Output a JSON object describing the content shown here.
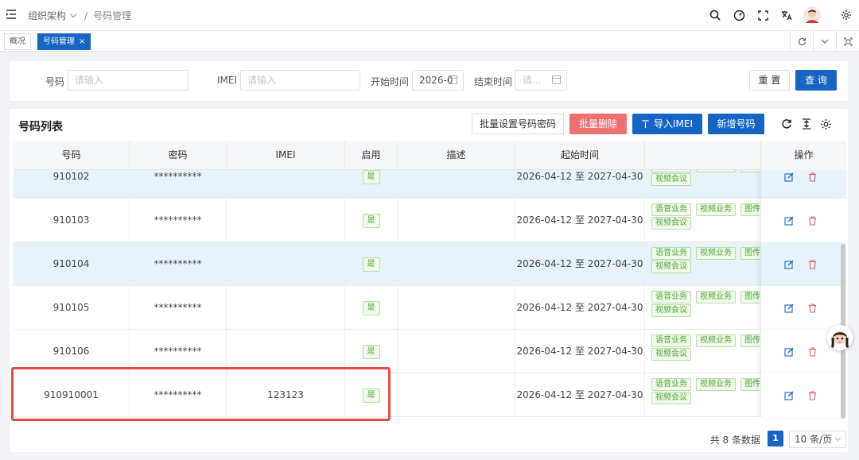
{
  "breadcrumb": {
    "parent": "组织架构",
    "separator": "/",
    "current": "号码管理"
  },
  "tabs": [
    {
      "label": "概况",
      "active": false
    },
    {
      "label": "号码管理",
      "active": true,
      "close": "×"
    }
  ],
  "filters": {
    "number_label": "号码",
    "number_placeholder": "请输入",
    "imei_label": "IMEI",
    "imei_placeholder": "请输入",
    "start_label": "开始时间",
    "start_value": "2026-0",
    "end_label": "结束时间",
    "end_placeholder": "请...",
    "reset_label": "重 置",
    "search_label": "查 询"
  },
  "list": {
    "title": "号码列表",
    "batch_password_label": "批量设置号码密码",
    "batch_delete_label": "批量删除",
    "import_label": "导入IMEI",
    "add_label": "新增号码"
  },
  "table": {
    "columns": [
      "号码",
      "密码",
      "IMEI",
      "启用",
      "描述",
      "起始时间",
      "操作"
    ],
    "business_tags": [
      "语音业务",
      "视频业务",
      "图传",
      "视频会议"
    ],
    "rows": [
      {
        "number": "910102",
        "password": "**********",
        "imei": "",
        "enabled": "是",
        "description": "",
        "period": "2026-04-12 至 2027-04-30",
        "highlight": true
      },
      {
        "number": "910103",
        "password": "**********",
        "imei": "",
        "enabled": "是",
        "description": "",
        "period": "2026-04-12 至 2027-04-30",
        "highlight": false
      },
      {
        "number": "910104",
        "password": "**********",
        "imei": "",
        "enabled": "是",
        "description": "",
        "period": "2026-04-12 至 2027-04-30",
        "highlight": true
      },
      {
        "number": "910105",
        "password": "**********",
        "imei": "",
        "enabled": "是",
        "description": "",
        "period": "2026-04-12 至 2027-04-30",
        "highlight": false
      },
      {
        "number": "910106",
        "password": "**********",
        "imei": "",
        "enabled": "是",
        "description": "",
        "period": "2026-04-12 至 2027-04-30",
        "highlight": false
      },
      {
        "number": "910910001",
        "password": "**********",
        "imei": "123123",
        "enabled": "是",
        "description": "",
        "period": "2026-04-12 至 2027-04-30",
        "highlight": false
      }
    ]
  },
  "pagination": {
    "total": "共 8 条数据",
    "page": "1",
    "page_size": "10 条/页"
  },
  "colors": {
    "primary": "#1664c4",
    "danger": "#f07070",
    "tag_green": "#52a43a",
    "row_highlight": "#e6f3fb",
    "annotation_red": "#e64c4c"
  }
}
